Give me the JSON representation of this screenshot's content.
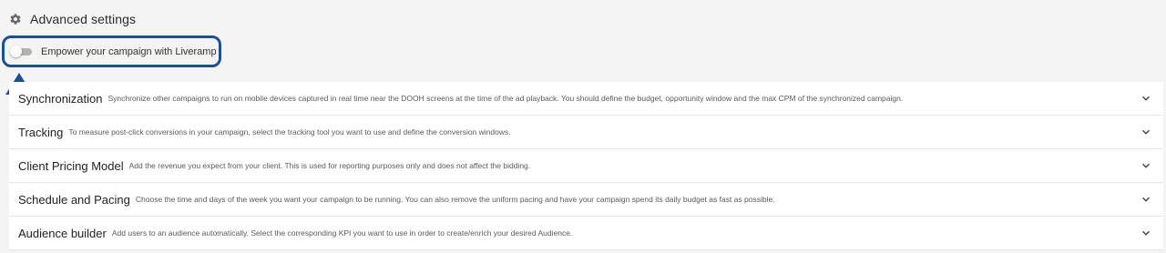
{
  "header": {
    "icon": "gear-icon",
    "title": "Advanced settings"
  },
  "liveramp": {
    "toggle_state": "off",
    "label": "Empower your campaign with Liveramp",
    "highlight_color": "#1e4f96"
  },
  "annotation": {
    "icon": "arrow-up-icon",
    "color": "#1e4f96"
  },
  "sections": [
    {
      "title": "Synchronization",
      "description": "Synchronize other campaigns to run on mobile devices captured in real time near the DOOH screens at the time of the ad playback. You should define the budget, opportunity window and the max CPM of the synchronized campaign.",
      "icon": "chevron-down-icon"
    },
    {
      "title": "Tracking",
      "description": "To measure post-click conversions in your campaign, select the tracking tool you want to use and define the conversion windows.",
      "icon": "chevron-down-icon"
    },
    {
      "title": "Client Pricing Model",
      "description": "Add the revenue you expect from your client. This is used for reporting purposes only and does not affect the bidding.",
      "icon": "chevron-down-icon"
    },
    {
      "title": "Schedule and Pacing",
      "description": "Choose the time and days of the week you want your campaign to be running. You can also remove the uniform pacing and have your campaign spend its daily budget as fast as possible.",
      "icon": "chevron-down-icon"
    },
    {
      "title": "Audience builder",
      "description": "Add users to an audience automatically. Select the corresponding KPI you want to use in order to create/enrich your desired Audience.",
      "icon": "chevron-down-icon"
    }
  ]
}
